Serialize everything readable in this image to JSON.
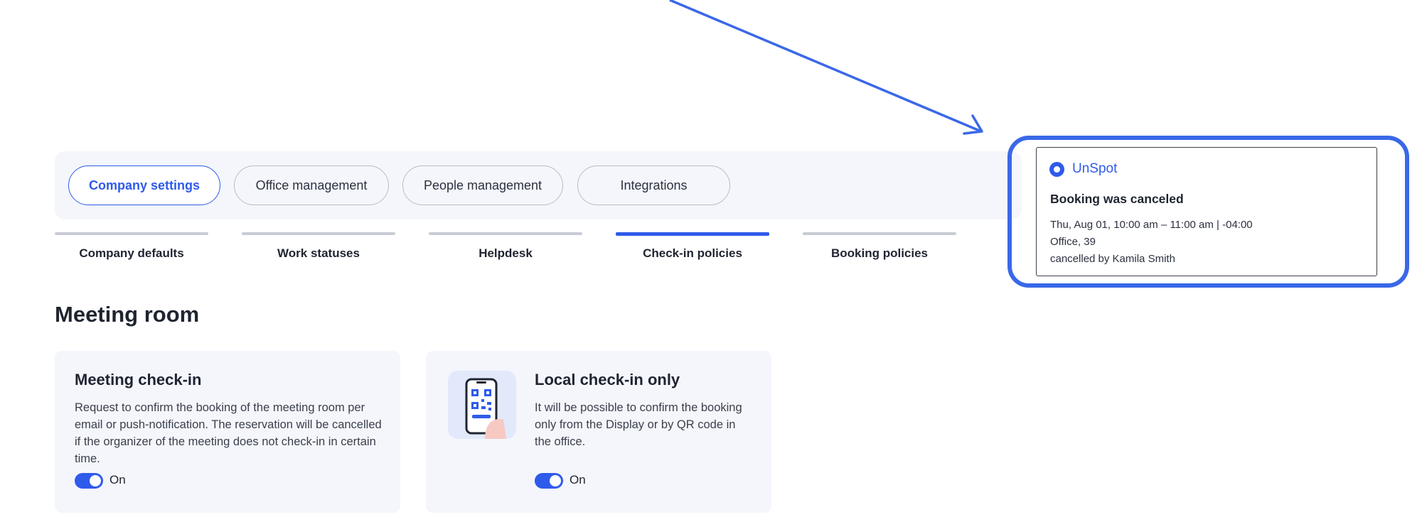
{
  "nav": {
    "tabs": [
      {
        "label": "Company settings",
        "active": true
      },
      {
        "label": "Office management",
        "active": false
      },
      {
        "label": "People management",
        "active": false
      },
      {
        "label": "Integrations",
        "active": false
      }
    ]
  },
  "subnav": {
    "tabs": [
      {
        "label": "Company defaults",
        "active": false
      },
      {
        "label": "Work statuses",
        "active": false
      },
      {
        "label": "Helpdesk",
        "active": false
      },
      {
        "label": "Check-in policies",
        "active": true
      },
      {
        "label": "Booking policies",
        "active": false
      }
    ]
  },
  "section": {
    "title": "Meeting room"
  },
  "cards": [
    {
      "title": "Meeting check-in",
      "description": "Request to confirm the booking of the meeting room per email or push-notification. The reservation will be cancelled if the organizer of the meeting does not check-in in certain time.",
      "toggle_on": true,
      "toggle_label": "On"
    },
    {
      "title": "Local check-in only",
      "description": "It will be possible to confirm the booking only from the Display or by QR code in the office.",
      "toggle_on": true,
      "toggle_label": "On",
      "icon": "phone-qr-illustration"
    }
  ],
  "notification": {
    "brand": "UnSpot",
    "title": "Booking was canceled",
    "datetime": "Thu, Aug 01, 10:00 am – 11:00 am | -04:00",
    "location": "Office, 39",
    "cancelled_by": "cancelled by Kamila Smith"
  },
  "colors": {
    "accent": "#2f5bea",
    "highlight": "#3a68e8",
    "card_bg": "#f4f6fc"
  }
}
